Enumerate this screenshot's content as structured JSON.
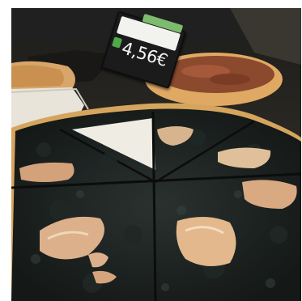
{
  "photo": {
    "subject": "",
    "price_tag": {
      "price": "4,56€",
      "product_name_line1": "",
      "product_name_line2": ""
    }
  }
}
